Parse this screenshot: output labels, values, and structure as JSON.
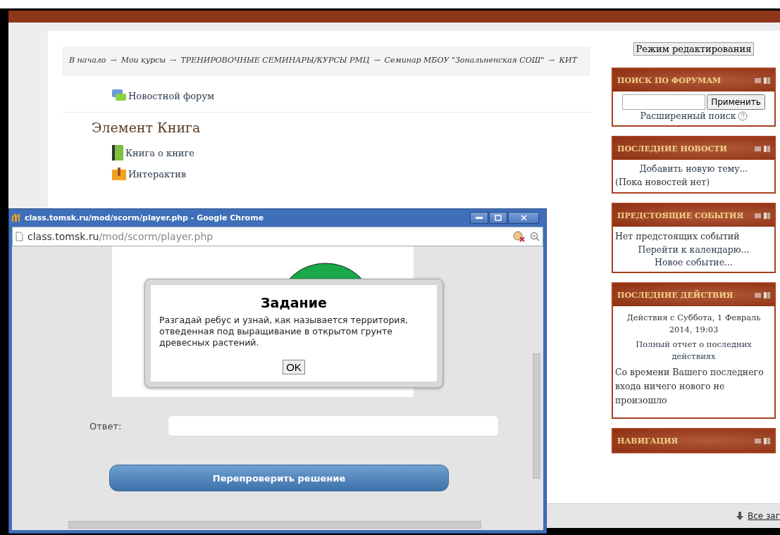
{
  "breadcrumb_separator": "→",
  "breadcrumb": [
    {
      "label": "В начало"
    },
    {
      "label": "Мои курсы"
    },
    {
      "label": "ТРЕНИРОВОЧНЫЕ СЕМИНАРЫ/КУРСЫ РМЦ"
    },
    {
      "label": "Семинар МБОУ \"Зональненская СОШ\""
    },
    {
      "label": "КИТ"
    }
  ],
  "forum_link": {
    "label": "Новостной форум",
    "kind": "forum"
  },
  "section": {
    "title": "Элемент Книга",
    "items": [
      {
        "label": "Книга о книге",
        "kind": "book"
      },
      {
        "label": "Интерактив",
        "kind": "package"
      }
    ]
  },
  "edit_button": "Режим редактирования",
  "blocks": [
    {
      "title": "ПОИСК ПО ФОРУМАМ",
      "kind": "search",
      "button": "Применить",
      "link": "Расширенный поиск"
    },
    {
      "title": "ПОСЛЕДНИЕ НОВОСТИ",
      "kind": "news",
      "link": "Добавить новую тему...",
      "note": "(Пока новостей нет)"
    },
    {
      "title": "ПРЕДСТОЯЩИЕ СОБЫТИЯ",
      "kind": "events",
      "note": "Нет предстоящих событий",
      "links": [
        "Перейти к календарю...",
        "Новое событие..."
      ]
    },
    {
      "title": "ПОСЛЕДНИЕ ДЕЙСТВИЯ",
      "kind": "activity",
      "since": "Действия с Суббота, 1 Февраль 2014, 19:03",
      "link": "Полный отчет о последних действиях",
      "note": "Со времени Вашего последнего входа ничего нового не произошло"
    },
    {
      "title": "НАВИГАЦИЯ",
      "kind": "nav"
    }
  ],
  "downloads": {
    "link": "Все заг"
  },
  "popup": {
    "title": "class.tomsk.ru/mod/scorm/player.php - Google Chrome",
    "url_host": "class.tomsk.ru",
    "url_path": "/mod/scorm/player.php",
    "dialog": {
      "title": "Задание",
      "text": "Разгадай ребус и узнай, как называется территория, отведенная под выращивание в открытом грунте древесных растений.",
      "button": "OK"
    },
    "answer_label": "Ответ:",
    "submit": "Перепроверить решение"
  }
}
